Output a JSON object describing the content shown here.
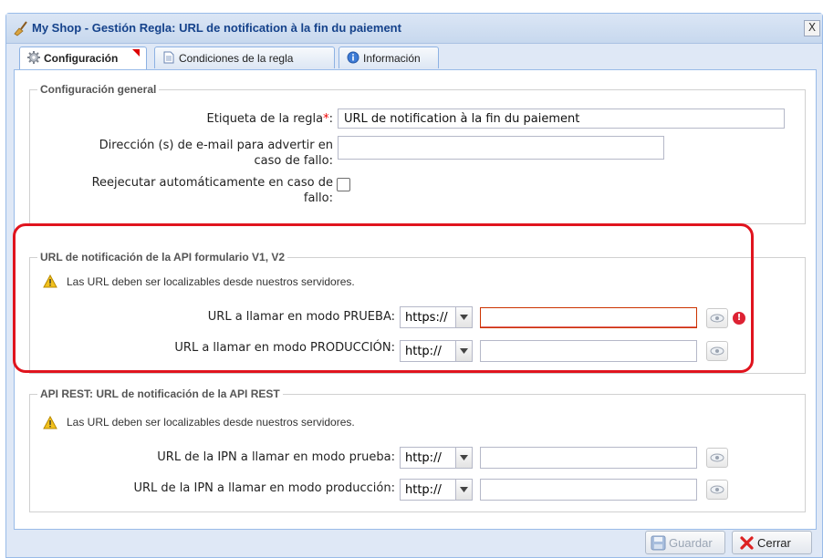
{
  "window": {
    "title": "My Shop - Gestión Regla: URL de notification à la fin du paiement",
    "close_label": "X"
  },
  "tabs": [
    {
      "label": "Configuración",
      "active": true,
      "icon": "gear-icon"
    },
    {
      "label": "Condiciones de la regla",
      "active": false,
      "icon": "document-icon"
    },
    {
      "label": "Información",
      "active": false,
      "icon": "info-icon"
    }
  ],
  "general": {
    "legend": "Configuración general",
    "rule_label": "Etiqueta de la regla",
    "rule_required_mark": "*",
    "rule_colon": ":",
    "rule_value": "URL de notification à la fin du paiement",
    "email_label_line1": "Dirección (s) de e-mail para advertir en",
    "email_label_line2": "caso de fallo:",
    "email_value": "",
    "retry_label_line1": "Reejecutar automáticamente en caso de",
    "retry_label_line2": "fallo:",
    "retry_checked": false
  },
  "api_form": {
    "legend": "URL de notificación de la API formulario V1, V2",
    "warning": "Las URL deben ser localizables desde nuestros servidores.",
    "test_label": "URL a llamar en modo PRUEBA:",
    "test_protocol": "https://",
    "test_value": "",
    "test_has_error": true,
    "prod_label": "URL a llamar en modo PRODUCCIÓN:",
    "prod_protocol": "http://",
    "prod_value": ""
  },
  "api_rest": {
    "legend": "API REST: URL de notificación de la API REST",
    "warning": "Las URL deben ser localizables desde nuestros servidores.",
    "test_label": "URL de la IPN a llamar en modo prueba:",
    "test_protocol": "http://",
    "test_value": "",
    "prod_label": "URL de la IPN a llamar en modo producción:",
    "prod_protocol": "http://",
    "prod_value": ""
  },
  "footer": {
    "save_label": "Guardar",
    "save_enabled": false,
    "close_label": "Cerrar"
  },
  "colors": {
    "highlight": "#e0141e",
    "title": "#15428b",
    "error": "#dd2233"
  }
}
